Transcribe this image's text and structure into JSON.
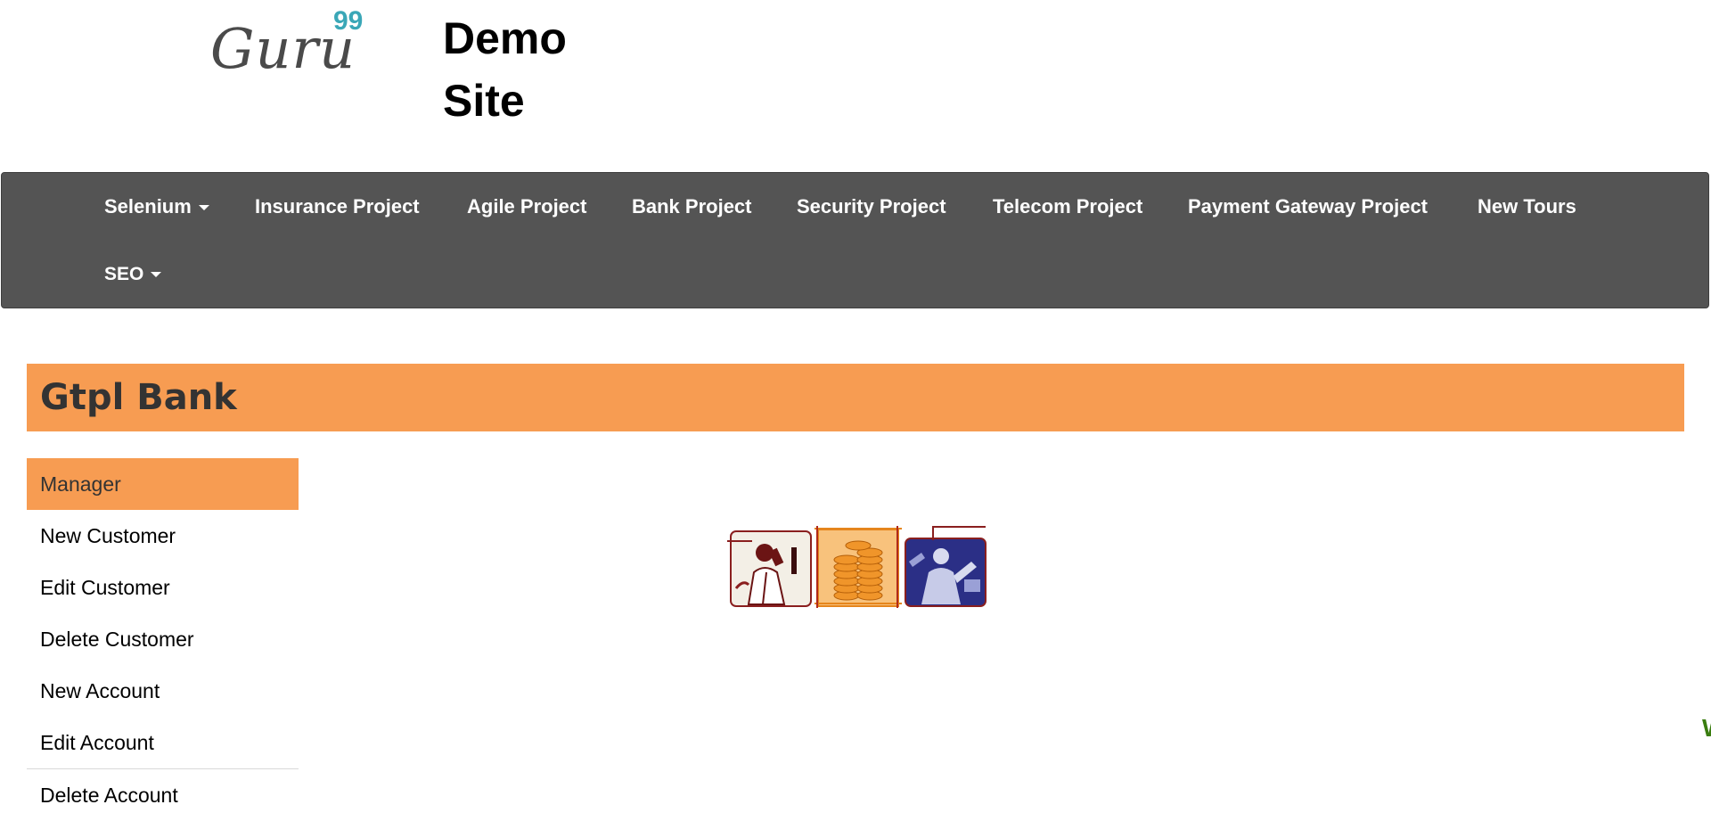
{
  "header": {
    "logo": {
      "word": "Guru",
      "sup": "99"
    },
    "site_title_line1": "Demo",
    "site_title_line2": "Site"
  },
  "nav": {
    "items": [
      {
        "label": "Selenium",
        "dropdown": true
      },
      {
        "label": "Insurance Project"
      },
      {
        "label": "Agile Project"
      },
      {
        "label": "Bank Project"
      },
      {
        "label": "Security Project"
      },
      {
        "label": "Telecom Project"
      },
      {
        "label": "Payment Gateway Project"
      },
      {
        "label": "New Tours"
      },
      {
        "label": "SEO",
        "dropdown": true
      }
    ]
  },
  "bank": {
    "title": "Gtpl Bank"
  },
  "sidebar": {
    "items": [
      {
        "label": "Manager",
        "active": true
      },
      {
        "label": "New Customer"
      },
      {
        "label": "Edit Customer"
      },
      {
        "label": "Delete Customer"
      },
      {
        "label": "New Account"
      },
      {
        "label": "Edit Account"
      },
      {
        "label": "Delete Account"
      }
    ]
  },
  "images": [
    {
      "name": "businessman-phone-image",
      "tint": "#7a1d1d"
    },
    {
      "name": "gold-coins-image",
      "tint": "#f0952a"
    },
    {
      "name": "worker-image",
      "tint": "#2b2f86"
    }
  ],
  "edge_text": "W",
  "colors": {
    "nav_bg": "#545454",
    "accent_orange": "#f79c52",
    "logo_grey": "#4a4a4a",
    "logo_teal": "#3aa7b7"
  }
}
